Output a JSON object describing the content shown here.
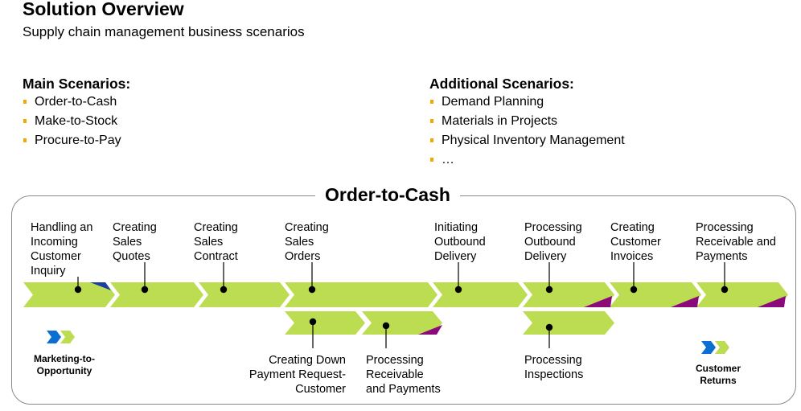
{
  "header": {
    "title": "Solution Overview",
    "subtitle": "Supply chain management business scenarios"
  },
  "main_scenarios": {
    "heading": "Main Scenarios:",
    "items": [
      "Order-to-Cash",
      "Make-to-Stock",
      "Procure-to-Pay"
    ]
  },
  "additional_scenarios": {
    "heading": "Additional Scenarios:",
    "items": [
      "Demand Planning",
      "Materials in Projects",
      "Physical Inventory Management",
      "…"
    ]
  },
  "process": {
    "title": "Order-to-Cash",
    "colors": {
      "chevron": "#bcdc52",
      "marker_blue": "#1a3fa0",
      "marker_purple": "#8b0a7a",
      "bullet": "#f0ab00",
      "scenario_blue": "#0a6fd0"
    },
    "main_steps": [
      {
        "label": "Handling an Incoming Customer Inquiry",
        "lines": [
          "Handling an",
          "Incoming",
          "Customer",
          "Inquiry"
        ],
        "corner_marker": "blue"
      },
      {
        "label": "Creating Sales Quotes",
        "lines": [
          "Creating",
          "Sales",
          "Quotes"
        ],
        "corner_marker": "none"
      },
      {
        "label": "Creating Sales Contract",
        "lines": [
          "Creating",
          "Sales",
          "Contract"
        ],
        "corner_marker": "none"
      },
      {
        "label": "Creating Sales Orders",
        "lines": [
          "Creating",
          "Sales",
          "Orders"
        ],
        "corner_marker": "none"
      },
      {
        "label": "Initiating Outbound Delivery",
        "lines": [
          "Initiating",
          "Outbound",
          "Delivery"
        ],
        "corner_marker": "none"
      },
      {
        "label": "Processing Outbound Delivery",
        "lines": [
          "Processing",
          "Outbound",
          "Delivery"
        ],
        "corner_marker": "purple"
      },
      {
        "label": "Creating Customer Invoices",
        "lines": [
          "Creating",
          "Customer",
          "Invoices"
        ],
        "corner_marker": "purple"
      },
      {
        "label": "Processing Receivable and Payments",
        "lines": [
          "Processing",
          "Receivable and",
          "Payments"
        ],
        "corner_marker": "purple"
      }
    ],
    "sub_steps": [
      {
        "label": "Creating Down Payment Request-Customer",
        "lines": [
          "Creating Down",
          "Payment Request-",
          "Customer"
        ],
        "corner_marker": "none"
      },
      {
        "label": "Processing Receivable and Payments",
        "lines": [
          "Processing",
          "Receivable",
          "and Payments"
        ],
        "corner_marker": "purple"
      },
      {
        "label": "Processing Inspections",
        "lines": [
          "Processing",
          "Inspections"
        ],
        "corner_marker": "none"
      }
    ],
    "linked_scenarios": [
      {
        "label": "Marketing-to-Opportunity",
        "lines": [
          "Marketing-to-",
          "Opportunity"
        ],
        "icon": "double-chevron"
      },
      {
        "label": "Customer Returns",
        "lines": [
          "Customer",
          "Returns"
        ],
        "icon": "double-chevron"
      }
    ]
  }
}
